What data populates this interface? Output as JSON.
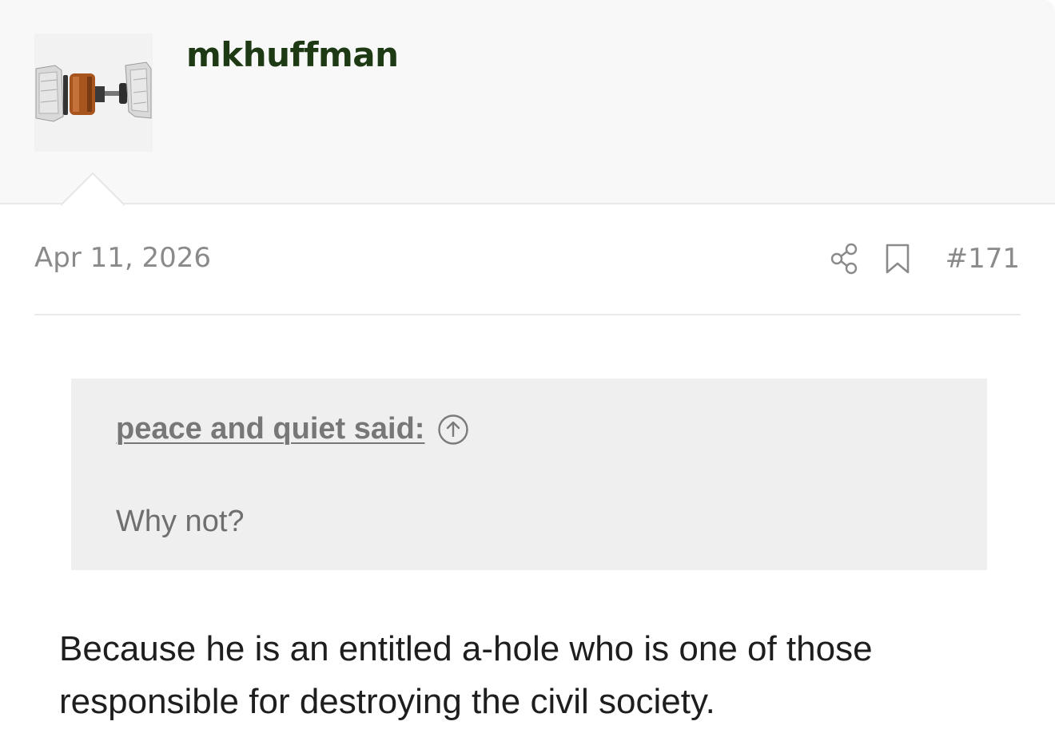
{
  "post": {
    "author": "mkhuffman",
    "avatar_icon": "transmission-parts-image",
    "date": "Apr 11, 2026",
    "post_number": "#171",
    "actions": {
      "share_icon": "share-icon",
      "bookmark_icon": "bookmark-icon"
    },
    "quote": {
      "attribution": "peace and quiet said:",
      "jump_icon": "arrow-up-circle-icon",
      "text": "Why not?"
    },
    "body": "Because he is an entitled a-hole who is one of those responsible for destroying the civil society."
  },
  "colors": {
    "author": "#1d3a14",
    "meta_text": "#8a8a8a",
    "quote_bg": "#efefef",
    "header_bg": "#f8f8f8"
  }
}
